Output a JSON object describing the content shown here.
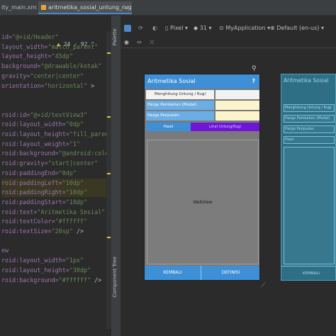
{
  "tabs": [
    {
      "label": "ity_main.xml"
    },
    {
      "label": "aritmetika_sosial_untung_rugi.xml",
      "close": "×"
    }
  ],
  "inspections": {
    "warnings": "24",
    "ok": "92",
    "warn_glyph": "▲",
    "ok_glyph": "✓",
    "chevron": "^"
  },
  "editor_lines": [
    {
      "a": "id=",
      "v": "\"@+id/Header\"",
      "tail": ""
    },
    {
      "a": "layout_width=",
      "v": "\"match_parent\"",
      "tail": ""
    },
    {
      "a": "layout_height=",
      "v": "\"45dp\"",
      "tail": ""
    },
    {
      "a": "background=",
      "v": "\"@drawable/kotak\"",
      "tail": ""
    },
    {
      "a": "gravity=",
      "v": "\"center|center\"",
      "tail": ""
    },
    {
      "a": "orientation=",
      "v": "\"horizontal\"",
      "tail": " >"
    },
    {
      "a": "",
      "v": "",
      "tail": ""
    },
    {
      "a": "",
      "v": "",
      "tail": ""
    },
    {
      "a": "roid:id=",
      "v": "\"@+id/textView3\"",
      "tail": ""
    },
    {
      "a": "roid:layout_width=",
      "v": "\"0dp\"",
      "tail": ""
    },
    {
      "a": "roid:layout_height=",
      "v": "\"fill_parent\"",
      "tail": ""
    },
    {
      "a": "roid:layout_weight=",
      "v": "\"1\"",
      "tail": ""
    },
    {
      "a": "roid:background=",
      "v": "\"@android:color/",
      "tail": ""
    },
    {
      "a": "roid:gravity=",
      "v": "\"start|center\"",
      "tail": ""
    },
    {
      "a": "roid:paddingEnd=",
      "v": "\"0dp\"",
      "tail": ""
    },
    {
      "a": "roid:paddingLeft=",
      "v": "\"10dp\"",
      "tail": ""
    },
    {
      "a": "roid:paddingRight=",
      "v": "\"10dp\"",
      "tail": ""
    },
    {
      "a": "roid:paddingStart=",
      "v": "\"10dp\"",
      "tail": ""
    },
    {
      "a": "roid:text=",
      "v": "\"Aritmetika Sosial\"",
      "tail": ""
    },
    {
      "a": "roid:textColor=",
      "v": "\"#ffffff\"",
      "tail": ""
    },
    {
      "a": "roid:textSize=",
      "v": "\"20sp\"",
      "tail": " />"
    },
    {
      "a": "",
      "v": "",
      "tail": ""
    },
    {
      "a": "ew",
      "v": "",
      "tail": ""
    },
    {
      "a": "roid:layout_width=",
      "v": "\"1px\"",
      "tail": ""
    },
    {
      "a": "roid:layout_height=",
      "v": "\"30dp\"",
      "tail": ""
    },
    {
      "a": "roid:background=",
      "v": "\"#ffffff\"",
      "tail": " />"
    }
  ],
  "side_strip": {
    "palette": "Palette",
    "component_tree": "Component Tree"
  },
  "toolbar": {
    "device": "Pixel",
    "api": "31",
    "app": "MyApplication",
    "locale": "Default (en-us)",
    "dropdown": "▾"
  },
  "phone": {
    "title": "Aritmetika Sosial",
    "help": "?",
    "top_label": "Menghitung Untung / Rugi",
    "field1": "Harga Pembelian (Modal)",
    "field2": "Harga Penjualan",
    "hasil_label": "Hasil",
    "hasil_value": "Lihat Untung/Rugi",
    "webview": "WebView",
    "btn_back": "KEMBALI",
    "btn_def": "DEFINISI"
  },
  "blueprint": {
    "title": "Aritmetika Sosial",
    "top": "Menghitung Untung / Rugi",
    "field1": "Harga Pembelian (Modal)",
    "field2": "Harga Penjualan",
    "hasil": "Hasil",
    "back": "KEMBALI"
  },
  "colors": {
    "accent_blue": "#3f8fd6",
    "purple": "#6f16d6",
    "input_yellow": "#fbf4cc",
    "blueprint": "#2e6f86"
  }
}
